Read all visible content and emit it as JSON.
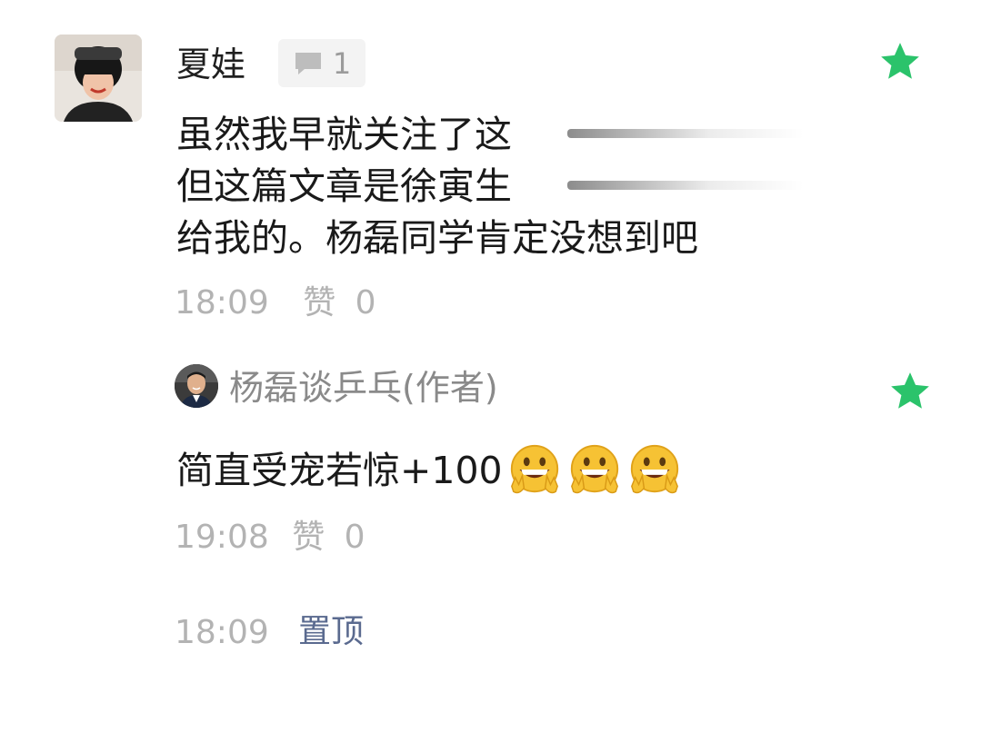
{
  "comment": {
    "name": "夏娃",
    "reply_count": "1",
    "lines": [
      "虽然我早就关注了这",
      "但这篇文章是徐寅生",
      "给我的。杨磊同学肯定没想到吧"
    ],
    "time": "18:09",
    "like_label": "赞",
    "like_count": "0",
    "star_icon": "star-icon",
    "star_color": "#2bc36b"
  },
  "reply": {
    "author": "杨磊谈乒乓(作者)",
    "text": "简直受宠若惊+100",
    "emojis": [
      "grin-victory-emoji",
      "grin-victory-emoji",
      "grin-victory-emoji"
    ],
    "time": "19:08",
    "like_label": "赞",
    "like_count": "0",
    "star_color": "#2bc36b"
  },
  "footer": {
    "time": "18:09",
    "pin_label": "置顶",
    "pin_color": "#5a6a8f"
  }
}
